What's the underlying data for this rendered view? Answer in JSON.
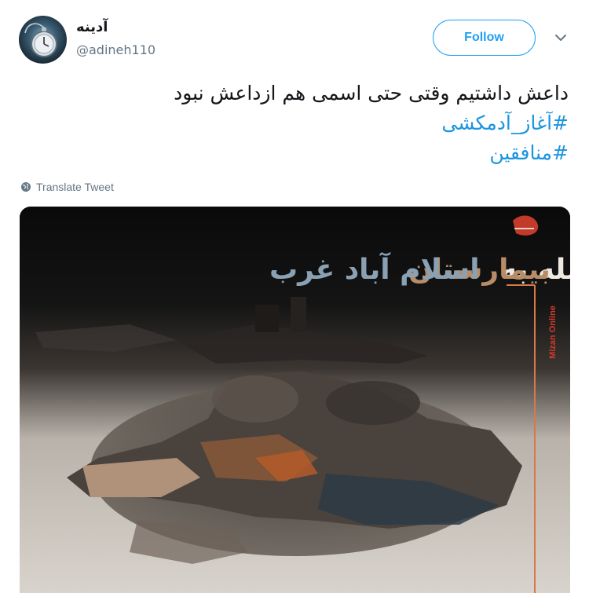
{
  "user": {
    "display_name": "آدینه",
    "handle": "@adineh110"
  },
  "actions": {
    "follow_label": "Follow"
  },
  "tweet": {
    "text": "داعش داشتیم وقتی حتی اسمی هم ازداعش نبود",
    "hashtags": [
      "#آغاز_آدمکشی",
      "#منافقین"
    ]
  },
  "translate_label": "Translate Tweet",
  "media": {
    "headline_dark": "حمله به",
    "headline_accent": "بیمارستان",
    "headline_blue": "اسلام آباد غرب",
    "watermark": "Mizan Online"
  },
  "colors": {
    "accent": "#1da1f2",
    "hashtag": "#1b95e0",
    "muted": "#657786"
  },
  "icons": {
    "caret": "chevron-down-icon",
    "translate": "globe-icon"
  }
}
